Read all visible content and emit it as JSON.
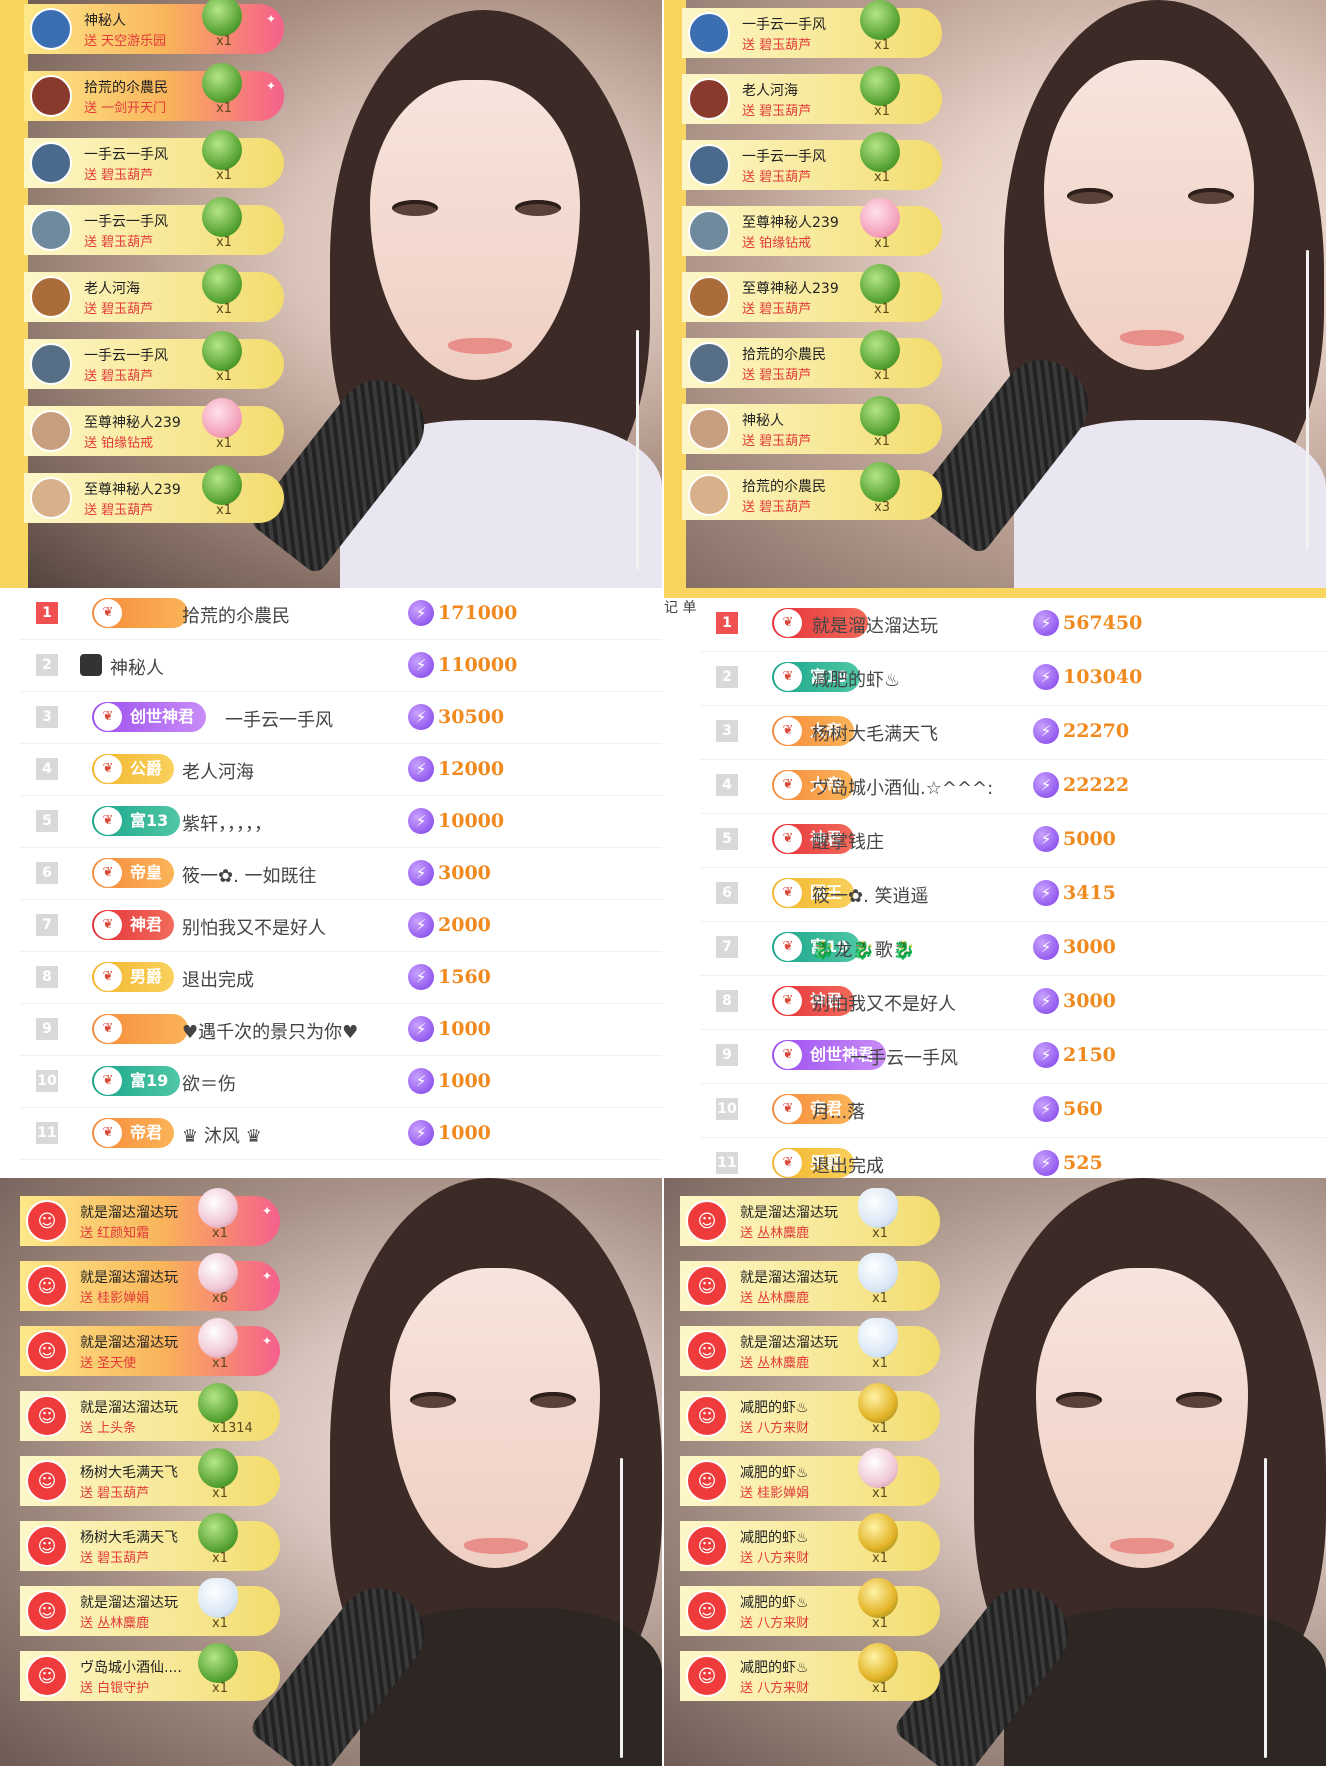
{
  "quad_top_left": {
    "gifts": [
      {
        "name": "神秘人",
        "action": "送 天空游乐园",
        "count": "x1",
        "style": "pink"
      },
      {
        "name": "拾荒的尒農民",
        "action": "送 一剑开天门",
        "count": "x1",
        "style": "pink"
      },
      {
        "name": "一手云一手风",
        "action": "送 碧玉葫芦",
        "count": "x1",
        "style": "yellow"
      },
      {
        "name": "一手云一手风",
        "action": "送 碧玉葫芦",
        "count": "x1",
        "style": "yellow"
      },
      {
        "name": "老人河海",
        "action": "送 碧玉葫芦",
        "count": "x1",
        "style": "yellow"
      },
      {
        "name": "一手云一手风",
        "action": "送 碧玉葫芦",
        "count": "x1",
        "style": "yellow"
      },
      {
        "name": "至尊神秘人239",
        "action": "送 铂缘钻戒",
        "count": "x1",
        "style": "yellow"
      },
      {
        "name": "至尊神秘人239",
        "action": "送 碧玉葫芦",
        "count": "x1",
        "style": "yellow"
      }
    ]
  },
  "quad_top_right": {
    "gifts": [
      {
        "name": "一手云一手风",
        "action": "送 碧玉葫芦",
        "count": "x1"
      },
      {
        "name": "老人河海",
        "action": "送 碧玉葫芦",
        "count": "x1"
      },
      {
        "name": "一手云一手风",
        "action": "送 碧玉葫芦",
        "count": "x1"
      },
      {
        "name": "至尊神秘人239",
        "action": "送 铂缘钻戒",
        "count": "x1"
      },
      {
        "name": "至尊神秘人239",
        "action": "送 碧玉葫芦",
        "count": "x1"
      },
      {
        "name": "拾荒的尒農民",
        "action": "送 碧玉葫芦",
        "count": "x1"
      },
      {
        "name": "神秘人",
        "action": "送 碧玉葫芦",
        "count": "x1"
      },
      {
        "name": "拾荒的尒農民",
        "action": "送 碧玉葫芦",
        "count": "x3"
      }
    ]
  },
  "leaderboard_left": {
    "rows": [
      {
        "rank": "1",
        "badge": "",
        "badge_color": "orange",
        "name": "拾荒的尒農民",
        "score": "171000"
      },
      {
        "rank": "2",
        "badge": "",
        "badge_color": "none",
        "name": "神秘人",
        "score": "110000"
      },
      {
        "rank": "3",
        "badge": "创世神君",
        "badge_color": "purple",
        "name": "一手云一手风",
        "score": "30500"
      },
      {
        "rank": "4",
        "badge": "公爵",
        "badge_color": "gold",
        "name": "老人河海",
        "score": "12000"
      },
      {
        "rank": "5",
        "badge": "富13",
        "badge_color": "teal",
        "name": "紫轩，，，，，",
        "score": "10000"
      },
      {
        "rank": "6",
        "badge": "帝皇",
        "badge_color": "orange",
        "name": "筱一✿. 一如既往",
        "score": "3000"
      },
      {
        "rank": "7",
        "badge": "神君",
        "badge_color": "red",
        "name": "别怕我又不是好人",
        "score": "2000"
      },
      {
        "rank": "8",
        "badge": "男爵",
        "badge_color": "gold",
        "name": "退出完成",
        "score": "1560"
      },
      {
        "rank": "9",
        "badge": "",
        "badge_color": "orange",
        "name": "♥遇千次的景只为你♥",
        "score": "1000"
      },
      {
        "rank": "10",
        "badge": "富19",
        "badge_color": "teal",
        "name": "欲＝伤",
        "score": "1000"
      },
      {
        "rank": "11",
        "badge": "帝君",
        "badge_color": "orange",
        "name": "♛ 沐风 ♛",
        "score": "1000"
      }
    ]
  },
  "leaderboard_right": {
    "edge_text": "记 单",
    "rows": [
      {
        "rank": "1",
        "badge": "",
        "badge_color": "red",
        "name": "就是溜达溜达玩",
        "score": "567450"
      },
      {
        "rank": "2",
        "badge": "富19",
        "badge_color": "teal",
        "name": "减肥的虾♨",
        "score": "103040"
      },
      {
        "rank": "3",
        "badge": "大帝",
        "badge_color": "orange",
        "name": "杨树大毛满天飞",
        "score": "22270"
      },
      {
        "rank": "4",
        "badge": "大帝",
        "badge_color": "orange",
        "name": "ヴ岛城小酒仙.☆^^^:",
        "score": "22222"
      },
      {
        "rank": "5",
        "badge": "神君",
        "badge_color": "red",
        "name": "醒掌钱庄",
        "score": "5000"
      },
      {
        "rank": "6",
        "badge": "国王",
        "badge_color": "gold",
        "name": "筱一✿. 笑逍遥",
        "score": "3415"
      },
      {
        "rank": "7",
        "badge": "富19",
        "badge_color": "teal",
        "name": "🐉龙🐉歌🐉",
        "score": "3000"
      },
      {
        "rank": "8",
        "badge": "神君",
        "badge_color": "red",
        "name": "别怕我又不是好人",
        "score": "3000"
      },
      {
        "rank": "9",
        "badge": "创世神君",
        "badge_color": "purple",
        "name": "一手云一手风",
        "score": "2150"
      },
      {
        "rank": "10",
        "badge": "帝君",
        "badge_color": "orange",
        "name": "月...落",
        "score": "560"
      },
      {
        "rank": "11",
        "badge": "男爵",
        "badge_color": "gold",
        "name": "退出完成",
        "score": "525"
      }
    ]
  },
  "quad_bottom_left": {
    "gifts": [
      {
        "name": "就是溜达溜达玩",
        "action": "送 红颜知霜",
        "count": "x1",
        "style": "pink"
      },
      {
        "name": "就是溜达溜达玩",
        "action": "送 桂影婵娟",
        "count": "x6",
        "style": "pink"
      },
      {
        "name": "就是溜达溜达玩",
        "action": "送 圣天使",
        "count": "x1",
        "style": "pink"
      },
      {
        "name": "就是溜达溜达玩",
        "action": "送 上头条",
        "count": "x1314",
        "style": "yellow"
      },
      {
        "name": "杨树大毛满天飞",
        "action": "送 碧玉葫芦",
        "count": "x1",
        "style": "yellow"
      },
      {
        "name": "杨树大毛满天飞",
        "action": "送 碧玉葫芦",
        "count": "x1",
        "style": "yellow"
      },
      {
        "name": "就是溜达溜达玩",
        "action": "送 丛林麋鹿",
        "count": "x1",
        "style": "yellow"
      },
      {
        "name": "ヴ岛城小酒仙....",
        "action": "送 白银守护",
        "count": "x1",
        "style": "yellow"
      }
    ]
  },
  "quad_bottom_right": {
    "gifts": [
      {
        "name": "就是溜达溜达玩",
        "action": "送 丛林麋鹿",
        "count": "x1"
      },
      {
        "name": "就是溜达溜达玩",
        "action": "送 丛林麋鹿",
        "count": "x1"
      },
      {
        "name": "就是溜达溜达玩",
        "action": "送 丛林麋鹿",
        "count": "x1"
      },
      {
        "name": "减肥的虾♨",
        "action": "送 八方来财",
        "count": "x1"
      },
      {
        "name": "减肥的虾♨",
        "action": "送 桂影婵娟",
        "count": "x1"
      },
      {
        "name": "减肥的虾♨",
        "action": "送 八方来财",
        "count": "x1"
      },
      {
        "name": "减肥的虾♨",
        "action": "送 八方来财",
        "count": "x1"
      },
      {
        "name": "减肥的虾♨",
        "action": "送 八方来财",
        "count": "x1"
      }
    ]
  },
  "icons": {
    "bolt": "⚡",
    "badge_symbol": "❦",
    "sparkle": "✦"
  },
  "colors": {
    "yellow_frame": "#f7d55f",
    "first_rank": "#f0504f",
    "score": "#f08a1e"
  }
}
